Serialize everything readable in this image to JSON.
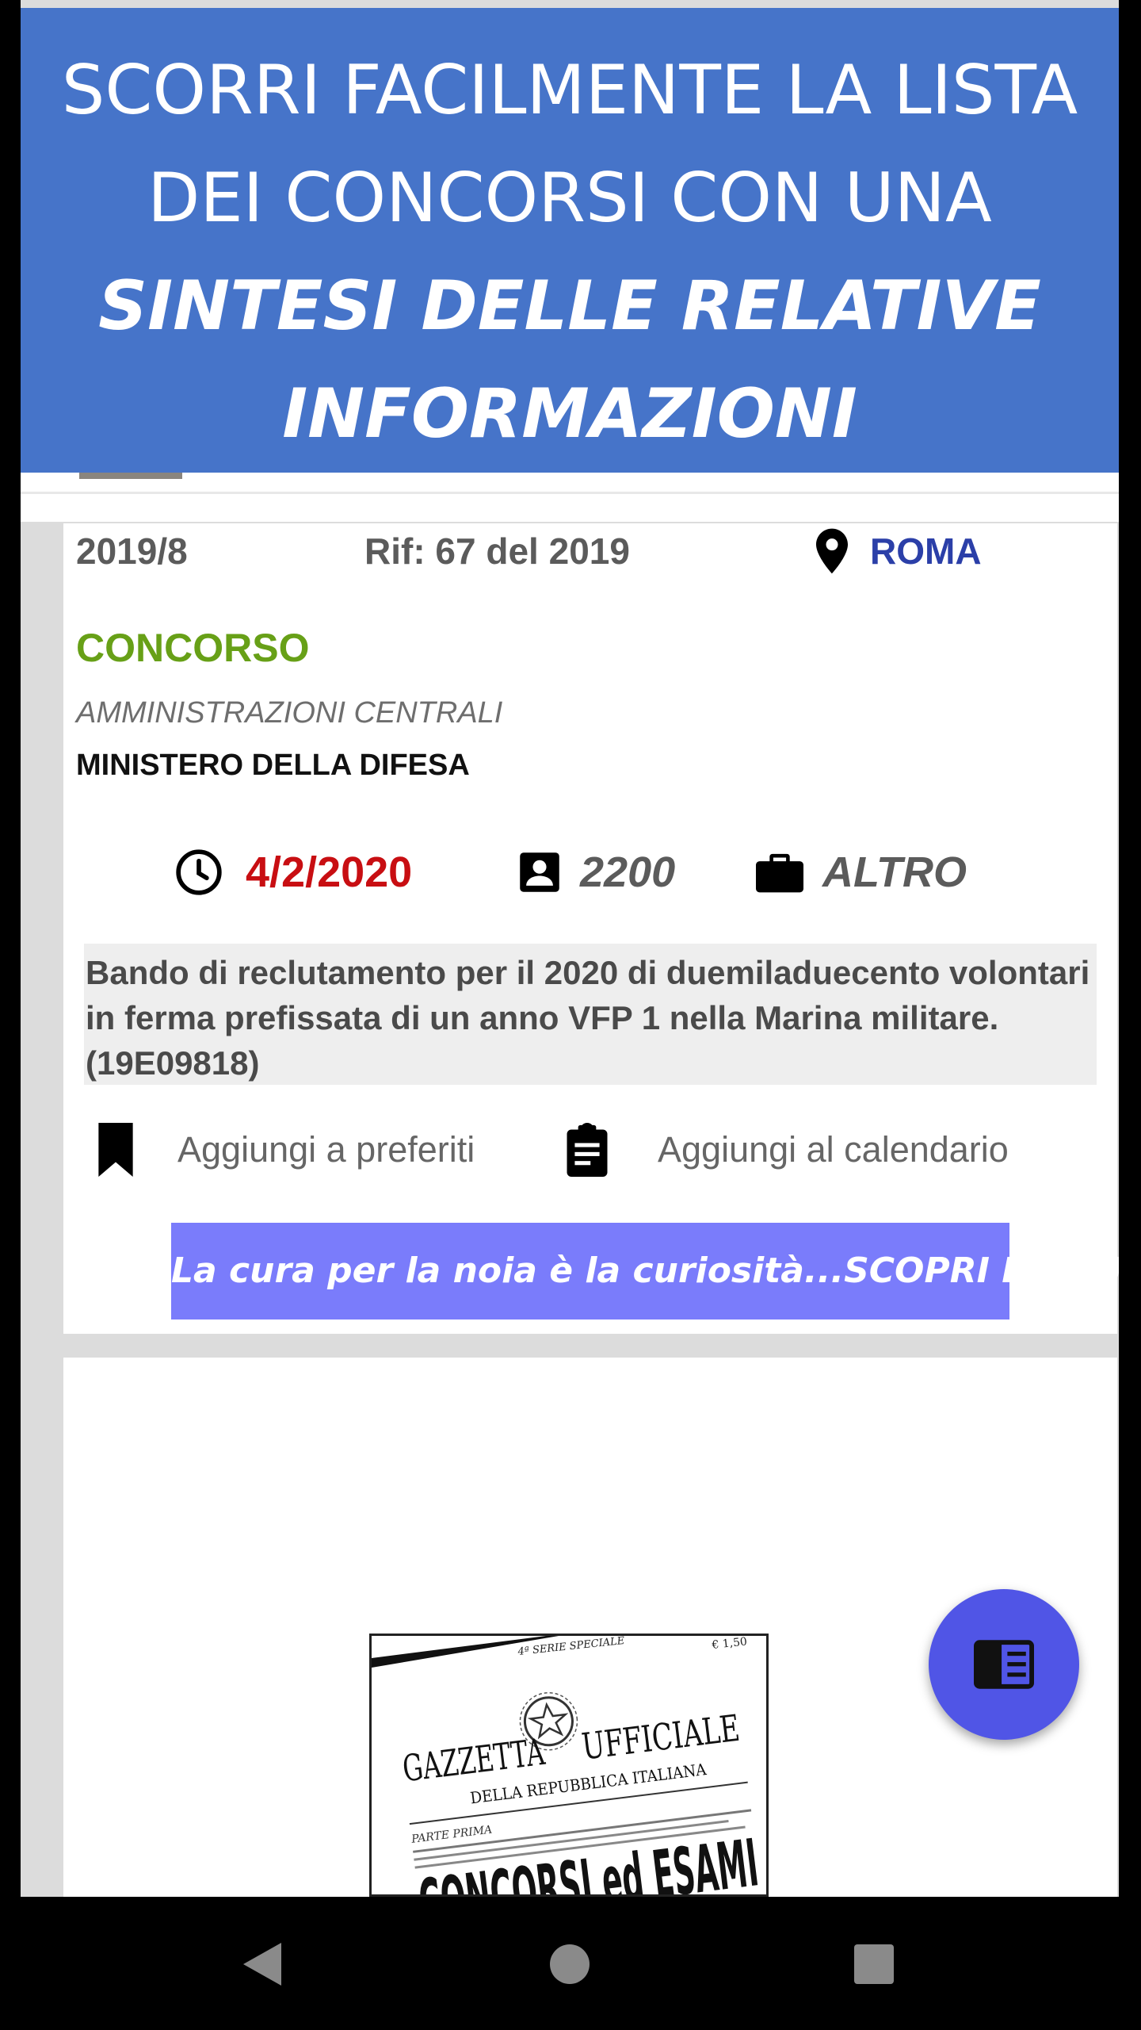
{
  "banner": {
    "line1": "SCORRI FACILMENTE LA LISTA",
    "line2": "DEI CONCORSI CON UNA",
    "line3": "SINTESI DELLE RELATIVE",
    "line4": "INFORMAZIONI"
  },
  "card": {
    "number": "2019/8",
    "reference": "Rif: 67 del 2019",
    "location": "ROMA",
    "type": "CONCORSO",
    "category": "AMMINISTRAZIONI CENTRALI",
    "entity": "MINISTERO DELLA DIFESA",
    "deadline": "4/2/2020",
    "positions": "2200",
    "job_type": "ALTRO",
    "description": "Bando di reclutamento per il 2020 di duemiladuecento volontari in ferma prefissata di un anno VFP 1 nella Marina militare. (19E09818)",
    "add_favorites": "Aggiungi a preferiti",
    "add_calendar": "Aggiungi al calendario",
    "promo": "La cura per la noia è la curiosità...SCOPRI DI PIU'"
  },
  "gazzetta": {
    "header_left": "4ª SERIE SPECIALE",
    "price": "€ 1,50",
    "title_left": "GAZZETTA",
    "title_right": "UFFICIALE",
    "subtitle": "DELLA REPUBBLICA ITALIANA",
    "part": "PARTE PRIMA",
    "big": "CONCORSI ed ESAMI"
  },
  "colors": {
    "banner": "#4674c9",
    "concorso_green": "#67a017",
    "deadline_red": "#c80e12",
    "location_blue": "#2b3fa8",
    "promo_purple": "#7a7cfb",
    "fab": "#5055e6"
  },
  "icons": {
    "location": "map-pin-icon",
    "deadline": "clock-icon",
    "positions": "account-box-icon",
    "job_type": "briefcase-icon",
    "favorites": "bookmark-icon",
    "calendar": "clipboard-icon",
    "fab": "reader-mode-icon"
  }
}
